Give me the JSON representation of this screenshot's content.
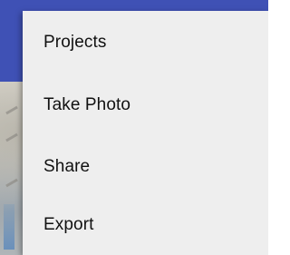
{
  "overflow_menu": {
    "items": [
      {
        "label": "Projects"
      },
      {
        "label": "Take Photo"
      },
      {
        "label": "Share"
      },
      {
        "label": "Export"
      }
    ]
  },
  "colors": {
    "app_bar": "#3f51b5",
    "menu_background": "#eeeeee",
    "menu_text": "#111111"
  }
}
